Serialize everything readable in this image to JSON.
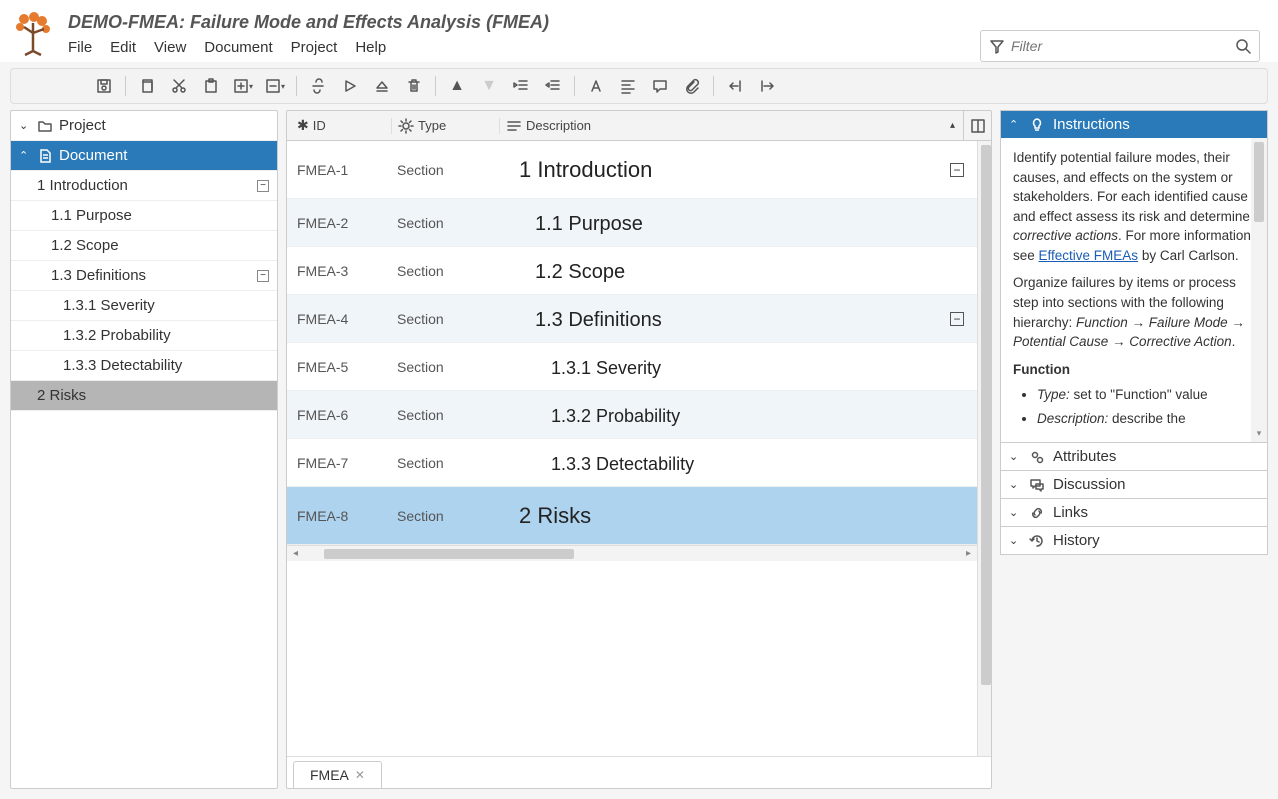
{
  "header": {
    "title": "DEMO-FMEA: Failure Mode and Effects Analysis (FMEA)",
    "menu": [
      "File",
      "Edit",
      "View",
      "Document",
      "Project",
      "Help"
    ],
    "filter_placeholder": "Filter"
  },
  "sidebar": {
    "project_label": "Project",
    "document_label": "Document",
    "items": [
      {
        "label": "1 Introduction",
        "level": 1,
        "expandable": true,
        "expanded": true
      },
      {
        "label": "1.1 Purpose",
        "level": 2
      },
      {
        "label": "1.2 Scope",
        "level": 2
      },
      {
        "label": "1.3 Definitions",
        "level": 2,
        "expandable": true,
        "expanded": true
      },
      {
        "label": "1.3.1 Severity",
        "level": 3
      },
      {
        "label": "1.3.2 Probability",
        "level": 3
      },
      {
        "label": "1.3.3 Detectability",
        "level": 3
      },
      {
        "label": "2 Risks",
        "level": 1,
        "selected": true
      }
    ]
  },
  "grid": {
    "cols": {
      "id": "ID",
      "type": "Type",
      "desc": "Description"
    },
    "rows": [
      {
        "id": "FMEA-1",
        "type": "Section",
        "desc": "1 Introduction",
        "level": 1,
        "alt": false,
        "box": "minus"
      },
      {
        "id": "FMEA-2",
        "type": "Section",
        "desc": "1.1 Purpose",
        "level": 2,
        "alt": true
      },
      {
        "id": "FMEA-3",
        "type": "Section",
        "desc": "1.2 Scope",
        "level": 2,
        "alt": false
      },
      {
        "id": "FMEA-4",
        "type": "Section",
        "desc": "1.3 Definitions",
        "level": 2,
        "alt": true,
        "box": "minus"
      },
      {
        "id": "FMEA-5",
        "type": "Section",
        "desc": "1.3.1 Severity",
        "level": 3,
        "alt": false
      },
      {
        "id": "FMEA-6",
        "type": "Section",
        "desc": "1.3.2 Probability",
        "level": 3,
        "alt": true
      },
      {
        "id": "FMEA-7",
        "type": "Section",
        "desc": "1.3.3 Detectability",
        "level": 3,
        "alt": false
      },
      {
        "id": "FMEA-8",
        "type": "Section",
        "desc": "2 Risks",
        "level": 1,
        "alt": false,
        "selected": true
      }
    ],
    "tab_label": "FMEA"
  },
  "right": {
    "instructions": {
      "title": "Instructions",
      "p1": "Identify potential failure modes, their causes, and effects on the system or stakeholders. For each identified cause and effect assess its risk and determine ",
      "p1_em": "corrective actions",
      "p1_tail": ". For more information see ",
      "link": "Effective FMEAs",
      "p1_tail2": " by Carl Carlson.",
      "p2": "Organize failures by items or process step into sections with the following hierarchy: ",
      "p2_em": "Function → Failure Mode → Potential Cause → Corrective Action",
      "p2_tail": ".",
      "func_label": "Function",
      "b1_em": "Type:",
      "b1": " set to \"Function\" value",
      "b2_em": "Description:",
      "b2": " describe the"
    },
    "panels": [
      "Attributes",
      "Discussion",
      "Links",
      "History"
    ]
  }
}
